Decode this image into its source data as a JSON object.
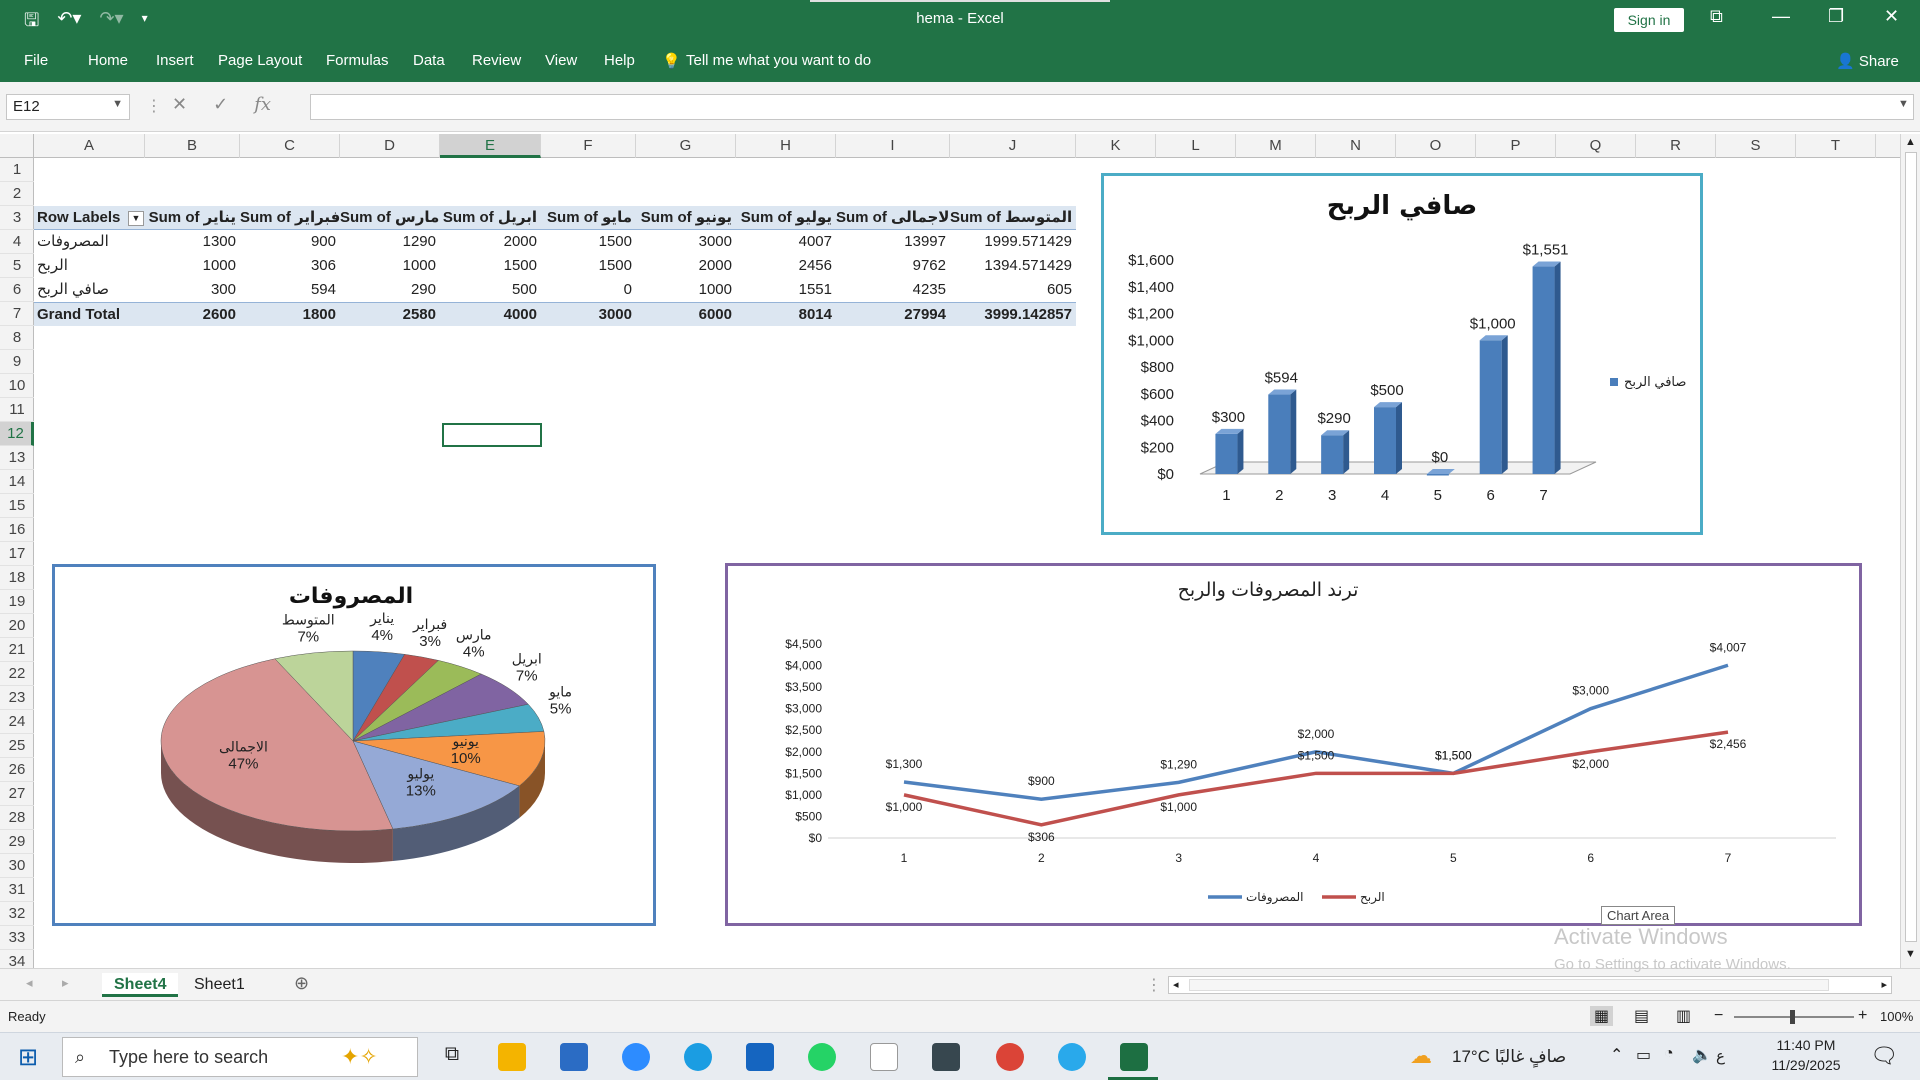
{
  "app": {
    "title": "hema  -  Excel",
    "signin": "Sign in",
    "share": "Share"
  },
  "ribbon": {
    "tabs": [
      "File",
      "Home",
      "Insert",
      "Page Layout",
      "Formulas",
      "Data",
      "Review",
      "View",
      "Help"
    ],
    "tellme": "Tell me what you want to do"
  },
  "formula_bar": {
    "name_box": "E12",
    "formula": ""
  },
  "grid": {
    "columns": [
      "A",
      "B",
      "C",
      "D",
      "E",
      "F",
      "G",
      "H",
      "I",
      "J",
      "K",
      "L",
      "M",
      "N",
      "O",
      "P",
      "Q",
      "R",
      "S",
      "T"
    ],
    "rows": [
      "1",
      "2",
      "3",
      "4",
      "5",
      "6",
      "7",
      "8",
      "9",
      "10",
      "11",
      "12",
      "13",
      "14",
      "15",
      "16",
      "17",
      "18",
      "19",
      "20",
      "21",
      "22",
      "23",
      "24",
      "25",
      "26",
      "27",
      "28",
      "29",
      "30",
      "31",
      "32",
      "33",
      "34"
    ],
    "selected_cell": "E12"
  },
  "pivot": {
    "headers": [
      "Row Labels",
      "Sum of يناير",
      "Sum of فبراير",
      "Sum of مارس",
      "Sum of ابريل",
      "Sum of مايو",
      "Sum of يونيو",
      "Sum of يوليو",
      "Sum of الاجمالى",
      "Sum of المتوسط"
    ],
    "rows": [
      [
        "المصروفات",
        "1300",
        "900",
        "1290",
        "2000",
        "1500",
        "3000",
        "4007",
        "13997",
        "1999.571429"
      ],
      [
        "الربح",
        "1000",
        "306",
        "1000",
        "1500",
        "1500",
        "2000",
        "2456",
        "9762",
        "1394.571429"
      ],
      [
        "صافي الربح",
        "300",
        "594",
        "290",
        "500",
        "0",
        "1000",
        "1551",
        "4235",
        "605"
      ]
    ],
    "total": [
      "Grand Total",
      "2600",
      "1800",
      "2580",
      "4000",
      "3000",
      "6000",
      "8014",
      "27994",
      "3999.142857"
    ]
  },
  "chart_data": [
    {
      "type": "bar",
      "title": "صافي الربح",
      "categories": [
        "1",
        "2",
        "3",
        "4",
        "5",
        "6",
        "7"
      ],
      "series": [
        {
          "name": "صافي الربح",
          "values": [
            300,
            594,
            290,
            500,
            0,
            1000,
            1551
          ]
        }
      ],
      "data_labels": [
        "$300",
        "$594",
        "$290",
        "$500",
        "$0",
        "$1,000",
        "$1,551"
      ],
      "y_ticks": [
        "$0",
        "$200",
        "$400",
        "$600",
        "$800",
        "$1,000",
        "$1,200",
        "$1,400",
        "$1,600"
      ],
      "ylim": [
        0,
        1600
      ],
      "legend": "right",
      "color": "#4a7ebb"
    },
    {
      "type": "pie",
      "title": "المصروفات",
      "labels": [
        "يناير",
        "فبراير",
        "مارس",
        "ابريل",
        "مايو",
        "يونيو",
        "يوليو",
        "الاجمالى",
        "المتوسط"
      ],
      "percents": [
        "4%",
        "3%",
        "4%",
        "7%",
        "5%",
        "10%",
        "13%",
        "47%",
        "7%"
      ],
      "values": [
        1300,
        900,
        1290,
        2000,
        1500,
        3000,
        4007,
        13997,
        1999.571429
      ],
      "colors": [
        "#4f81bd",
        "#c0504d",
        "#9bbb59",
        "#8064a2",
        "#4bacc6",
        "#f79646",
        "#95a9d6",
        "#d79492",
        "#bcd49a"
      ]
    },
    {
      "type": "line",
      "title": "ترند المصروفات والربح",
      "categories": [
        "1",
        "2",
        "3",
        "4",
        "5",
        "6",
        "7"
      ],
      "series": [
        {
          "name": "المصروفات",
          "values": [
            1300,
            900,
            1290,
            2000,
            1500,
            3000,
            4007
          ],
          "labels": [
            "$1,300",
            "$900",
            "$1,290",
            "$2,000",
            "$1,500",
            "$3,000",
            "$4,007"
          ],
          "color": "#4f81bd"
        },
        {
          "name": "الربح",
          "values": [
            1000,
            306,
            1000,
            1500,
            1500,
            2000,
            2456
          ],
          "labels": [
            "$1,000",
            "$306",
            "$1,000",
            "$1,500",
            "$1,500",
            "$2,000",
            "$2,456"
          ],
          "color": "#c0504d"
        }
      ],
      "y_ticks": [
        "$0",
        "$500",
        "$1,000",
        "$1,500",
        "$2,000",
        "$2,500",
        "$3,000",
        "$3,500",
        "$4,000",
        "$4,500"
      ],
      "ylim": [
        0,
        4500
      ],
      "legend": "bottom",
      "tooltip": "Chart Area"
    }
  ],
  "sheets": {
    "tabs": [
      "Sheet4",
      "Sheet1"
    ],
    "active": "Sheet4"
  },
  "status": {
    "text": "Ready",
    "zoom": "100%"
  },
  "watermark": {
    "line1": "Activate Windows",
    "line2": "Go to Settings to activate Windows."
  },
  "taskbar": {
    "search": "Type here to search",
    "weather": "17°C  صافٍ غالبًا",
    "time": "11:40 PM",
    "date": "11/29/2025"
  }
}
